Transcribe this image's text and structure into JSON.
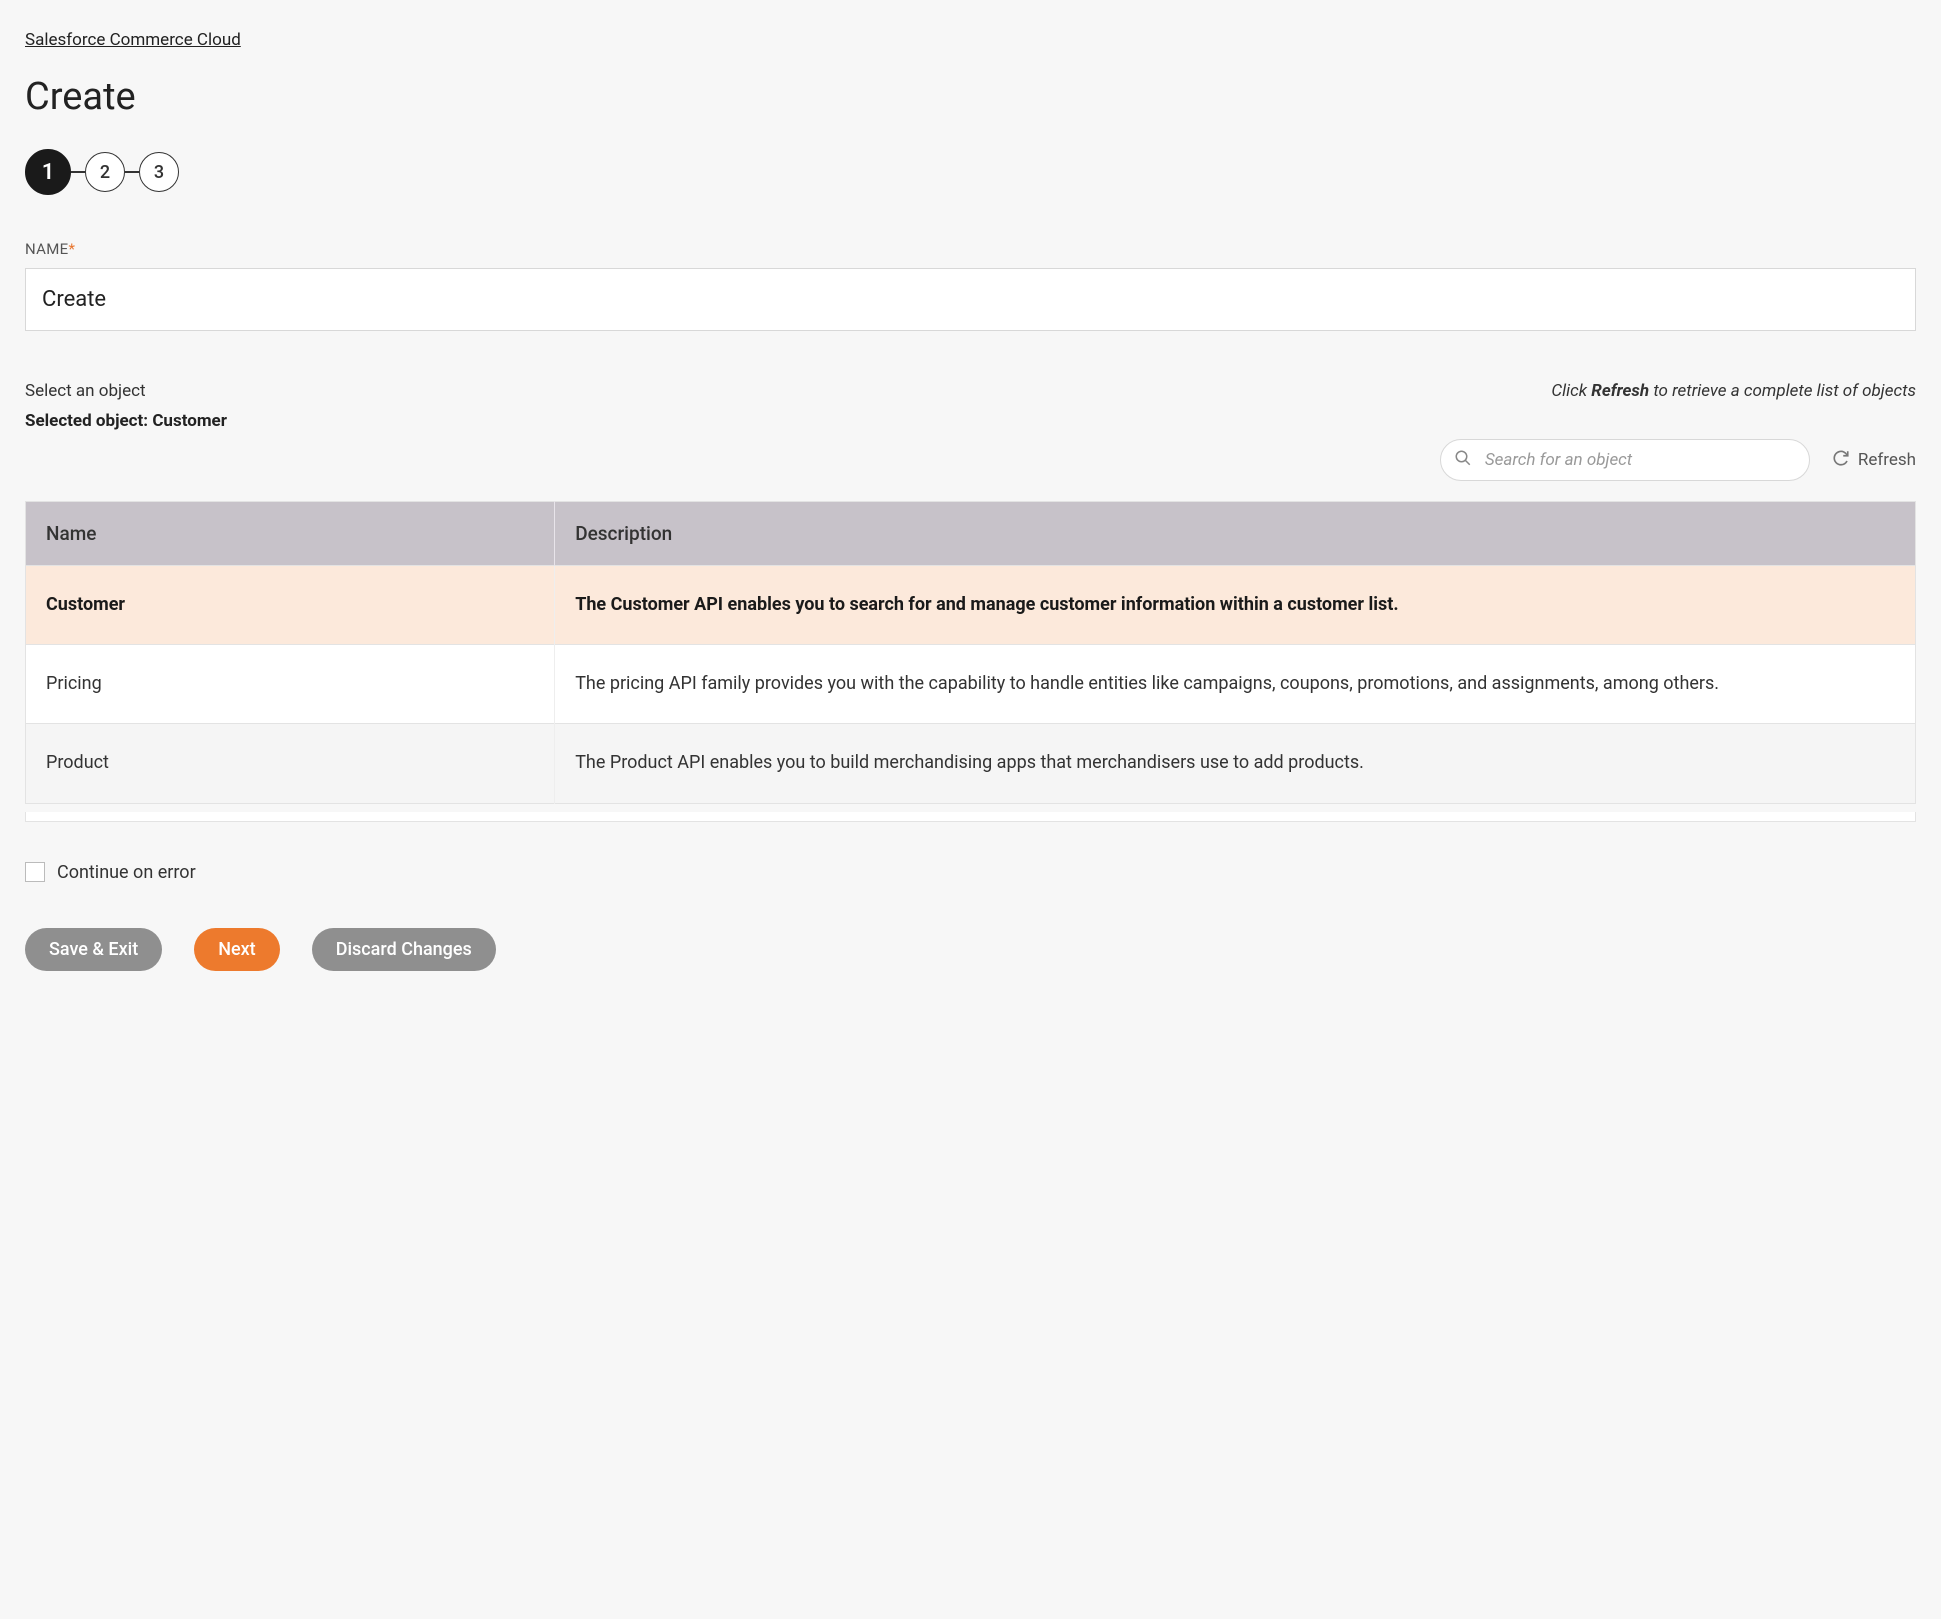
{
  "breadcrumb": "Salesforce Commerce Cloud",
  "pageTitle": "Create",
  "stepper": {
    "steps": [
      "1",
      "2",
      "3"
    ],
    "activeIndex": 0
  },
  "nameField": {
    "label": "NAME",
    "required": "*",
    "value": "Create"
  },
  "objectSelect": {
    "label": "Select an object",
    "selectedPrefix": "Selected object: ",
    "selectedName": "Customer",
    "refreshHintPrefix": "Click ",
    "refreshHintBold": "Refresh",
    "refreshHintSuffix": " to retrieve a complete list of objects",
    "searchPlaceholder": "Search for an object",
    "refreshLabel": "Refresh"
  },
  "table": {
    "headers": {
      "name": "Name",
      "description": "Description"
    },
    "rows": [
      {
        "name": "Customer",
        "description": "The Customer API enables you to search for and manage customer information within a customer list.",
        "selected": true
      },
      {
        "name": "Pricing",
        "description": "The pricing API family provides you with the capability to handle entities like campaigns, coupons, promotions, and assignments, among others.",
        "selected": false
      },
      {
        "name": "Product",
        "description": "The Product API enables you to build merchandising apps that merchandisers use to add products.",
        "selected": false
      }
    ]
  },
  "continueOnError": {
    "label": "Continue on error",
    "checked": false
  },
  "buttons": {
    "saveExit": "Save & Exit",
    "next": "Next",
    "discard": "Discard Changes"
  }
}
